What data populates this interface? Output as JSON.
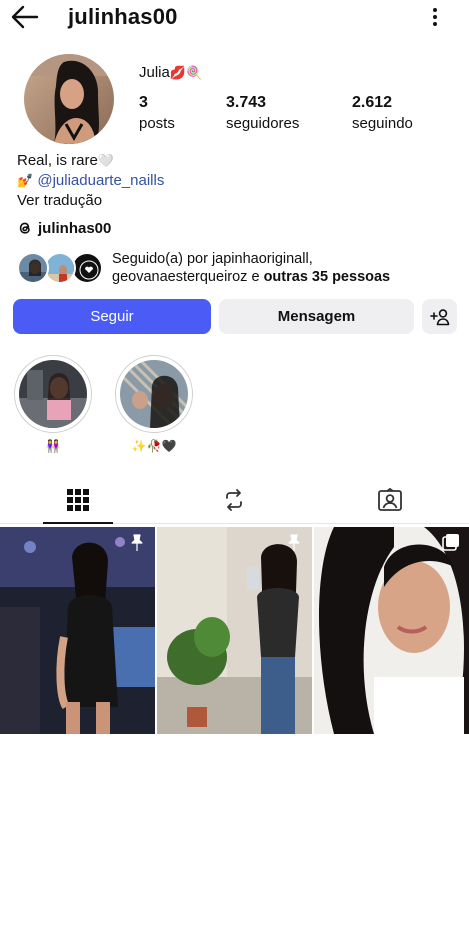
{
  "header": {
    "username": "julinhas00",
    "back_icon": "arrow-left-icon",
    "more_icon": "more-vertical-icon"
  },
  "profile": {
    "display_name": "Julia",
    "display_name_emoji": "💋🍭",
    "stats": {
      "posts": {
        "value": "3",
        "label": "posts"
      },
      "followers": {
        "value": "3.743",
        "label": "seguidores"
      },
      "following": {
        "value": "2.612",
        "label": "seguindo"
      }
    },
    "bio": {
      "line1_text": "Real, is rare",
      "line1_emoji": "🤍",
      "line2_emoji": "💅",
      "line2_mention": "@juliaduarte_naills",
      "translate": "Ver tradução"
    },
    "threads": {
      "icon": "threads-icon",
      "handle": "julinhas00"
    },
    "followed_by": {
      "prefix": "Seguido(a) por",
      "names_line1": "japinhaoriginall,",
      "names_line2": "geovanaesterqueiroz",
      "connector": "e",
      "others": "outras 35 pessoas"
    }
  },
  "actions": {
    "follow": "Seguir",
    "message": "Mensagem",
    "add_user_icon": "add-user-icon"
  },
  "highlights": [
    {
      "label": "👭"
    },
    {
      "label": "✨🥀🖤"
    }
  ],
  "tabs": [
    {
      "icon": "grid-icon",
      "active": true
    },
    {
      "icon": "reels-repost-icon",
      "active": false
    },
    {
      "icon": "tagged-icon",
      "active": false
    }
  ],
  "posts": [
    {
      "badge": "pin-icon"
    },
    {
      "badge": "pin-icon"
    },
    {
      "badge": "multiple-icon"
    }
  ],
  "colors": {
    "follow_bg": "#4a5cf5",
    "secondary_bg": "#efeff2",
    "mention": "#3552a0"
  }
}
